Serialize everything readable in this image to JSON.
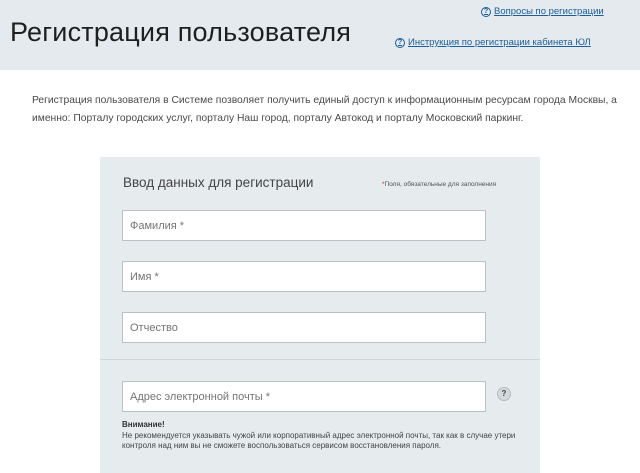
{
  "header": {
    "title": "Регистрация пользователя",
    "links": [
      {
        "icon": "question-circle-icon",
        "label": "Вопросы по регистрации"
      },
      {
        "icon": "question-circle-icon",
        "label": "Инструкция по регистрации кабинета ЮЛ"
      }
    ]
  },
  "intro": {
    "text": "Регистрация пользователя в Системе позволяет получить единый доступ к информационным ресурсам города Москвы, а именно: Порталу городских услуг, порталу Наш город, порталу Автокод и порталу Московский паркинг."
  },
  "form": {
    "title": "Ввод данных для регистрации",
    "required_star": "*",
    "required_note": "Поля, обязательные для заполнения",
    "fields": {
      "last_name": {
        "placeholder": "Фамилия *",
        "value": ""
      },
      "first_name": {
        "placeholder": "Имя *",
        "value": ""
      },
      "patronymic": {
        "placeholder": "Отчество",
        "value": ""
      },
      "email": {
        "placeholder": "Адрес электронной почты *",
        "value": ""
      }
    },
    "info_button": "?",
    "warning": {
      "title": "Внимание!",
      "text": "Не рекомендуется указывать чужой или корпоративный адрес электронной почты, так как в случае утери контроля над ним вы не сможете воспользоваться сервисом восстановления пароля."
    }
  },
  "colors": {
    "header_bg": "#e4eaed",
    "panel_bg": "#e6ebee",
    "link": "#1b5e9a",
    "required_mark": "#c0392b"
  }
}
